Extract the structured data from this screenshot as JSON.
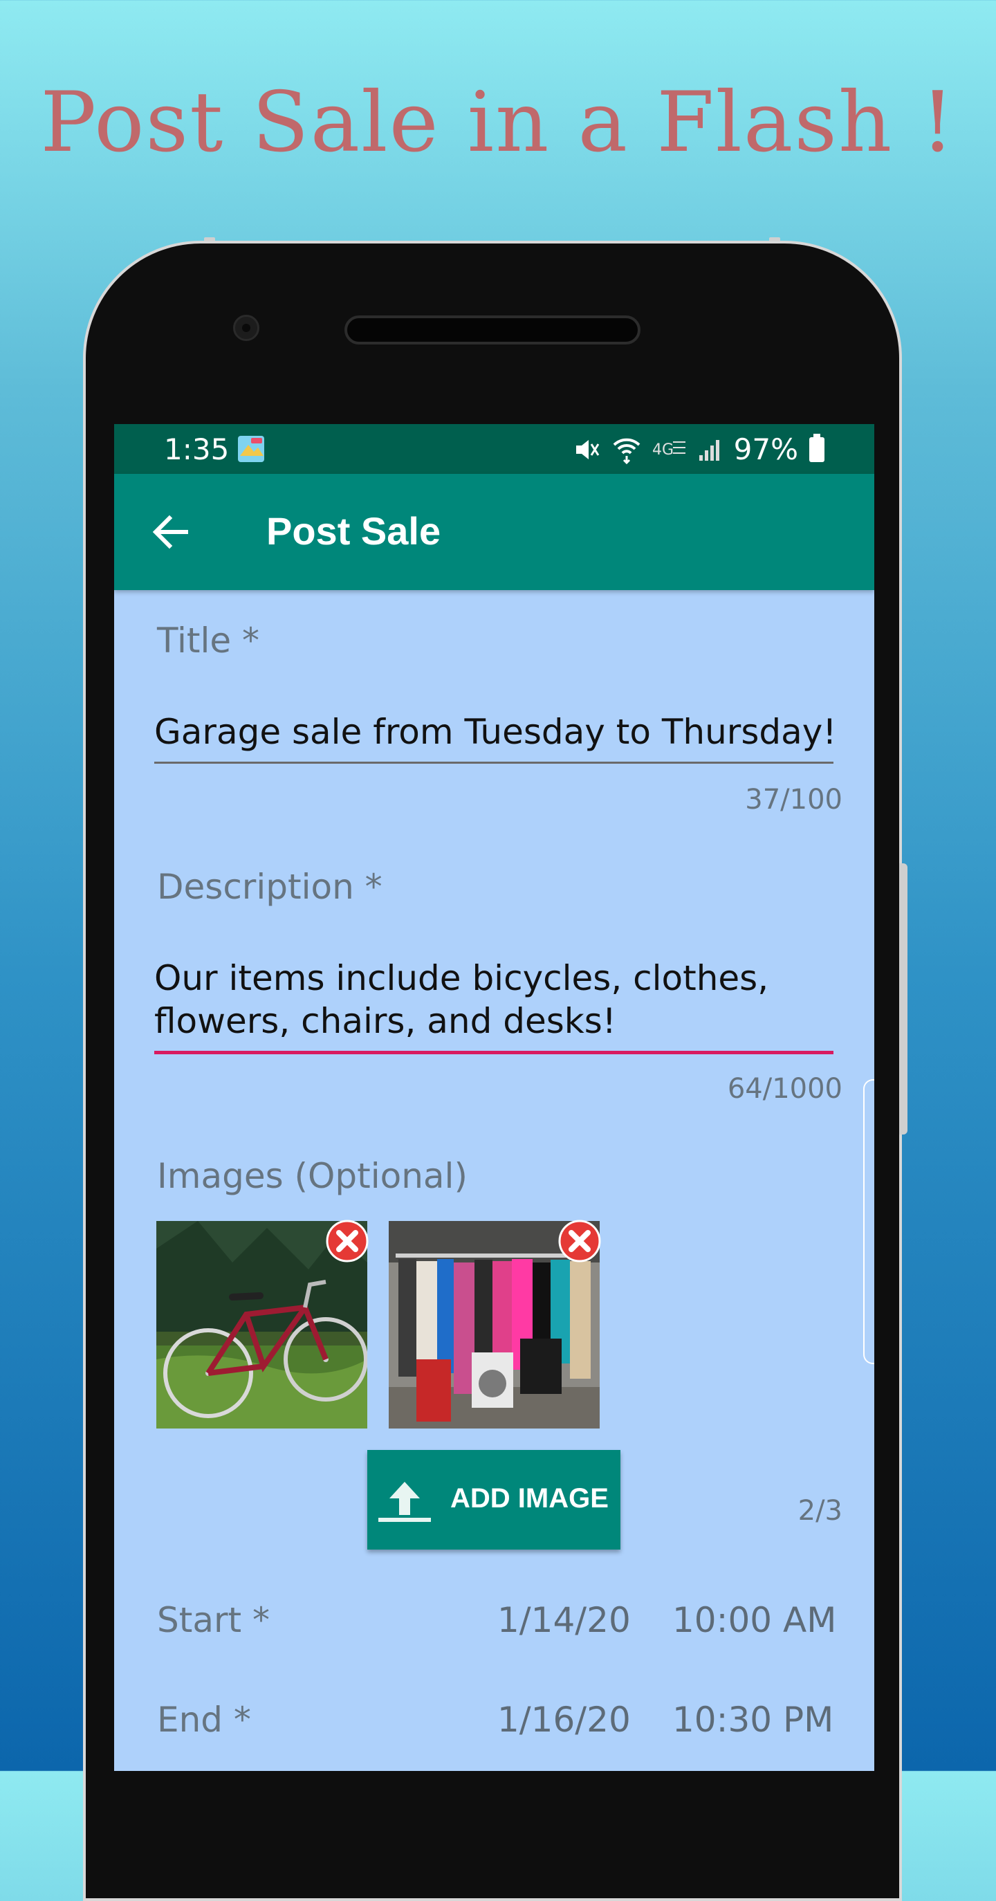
{
  "promo": {
    "headline": "Post Sale in a Flash !"
  },
  "status_bar": {
    "time": "1:35",
    "battery": "97%",
    "icons": [
      "app-notification-icon",
      "mute-icon",
      "wifi-icon",
      "lte-icon",
      "signal-icon",
      "battery-icon"
    ]
  },
  "app_bar": {
    "title": "Post Sale",
    "back_icon": "arrow-back-icon"
  },
  "form": {
    "title_field": {
      "label": "Title *",
      "value": "Garage sale from Tuesday to Thursday!",
      "counter": "37/100"
    },
    "description_field": {
      "label": "Description *",
      "line1": "Our items include bicycles, clothes,",
      "line2": "flowers, chairs, and desks!",
      "counter": "64/1000"
    },
    "images": {
      "label": "Images (Optional)",
      "items": [
        "bicycle-photo",
        "clothes-rack-photo"
      ],
      "counter": "2/3",
      "add_button_label": "ADD IMAGE"
    },
    "start": {
      "label": "Start *",
      "date": "1/14/20",
      "time": "10:00 AM"
    },
    "end": {
      "label": "End *",
      "date": "1/16/20",
      "time": "10:30 PM"
    }
  },
  "colors": {
    "primary": "#00877a",
    "primary_dark": "#005f4e",
    "accent": "#d81b60",
    "screen_background": "#aed1fb",
    "headline": "#c0696b"
  }
}
